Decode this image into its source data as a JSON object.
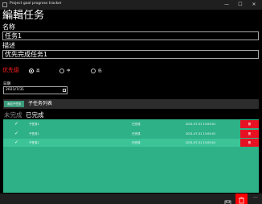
{
  "window": {
    "title": "Project goal progress tracker",
    "minimize": "—",
    "maximize": "☐",
    "close": "✕"
  },
  "page": {
    "title": "編輯任务"
  },
  "name_field": {
    "label": "名称",
    "value": "任务1"
  },
  "desc_field": {
    "label": "描述",
    "value": "优先完成任务1"
  },
  "priority": {
    "label": "优先级",
    "options": [
      {
        "label": "高",
        "selected": true
      },
      {
        "label": "中",
        "selected": false
      },
      {
        "label": "低",
        "selected": false
      }
    ]
  },
  "date": {
    "label": "日期",
    "value": "2021/7/31"
  },
  "subtask_tabs": {
    "add_label": "添加子任务",
    "list_label": "子任务列表"
  },
  "status_tabs": {
    "incomplete": "未完成",
    "complete": "已完成"
  },
  "subtasks": [
    {
      "name": "子任务1",
      "status": "已完成",
      "time": "2021-07-31 13:05:01",
      "delete": "删"
    },
    {
      "name": "子任务1",
      "status": "已完成",
      "time": "2021-07-31 13:05:01",
      "delete": "删"
    },
    {
      "name": "子任务1",
      "status": "已完成",
      "time": "2021-07-31 13:05:01",
      "delete": "删"
    }
  ],
  "command_bar": {
    "more": "···"
  },
  "colors": {
    "accent": "#2fb187",
    "row_highlight": "#3cc497",
    "delete": "#e81123",
    "priority_label": "#ff2020"
  }
}
